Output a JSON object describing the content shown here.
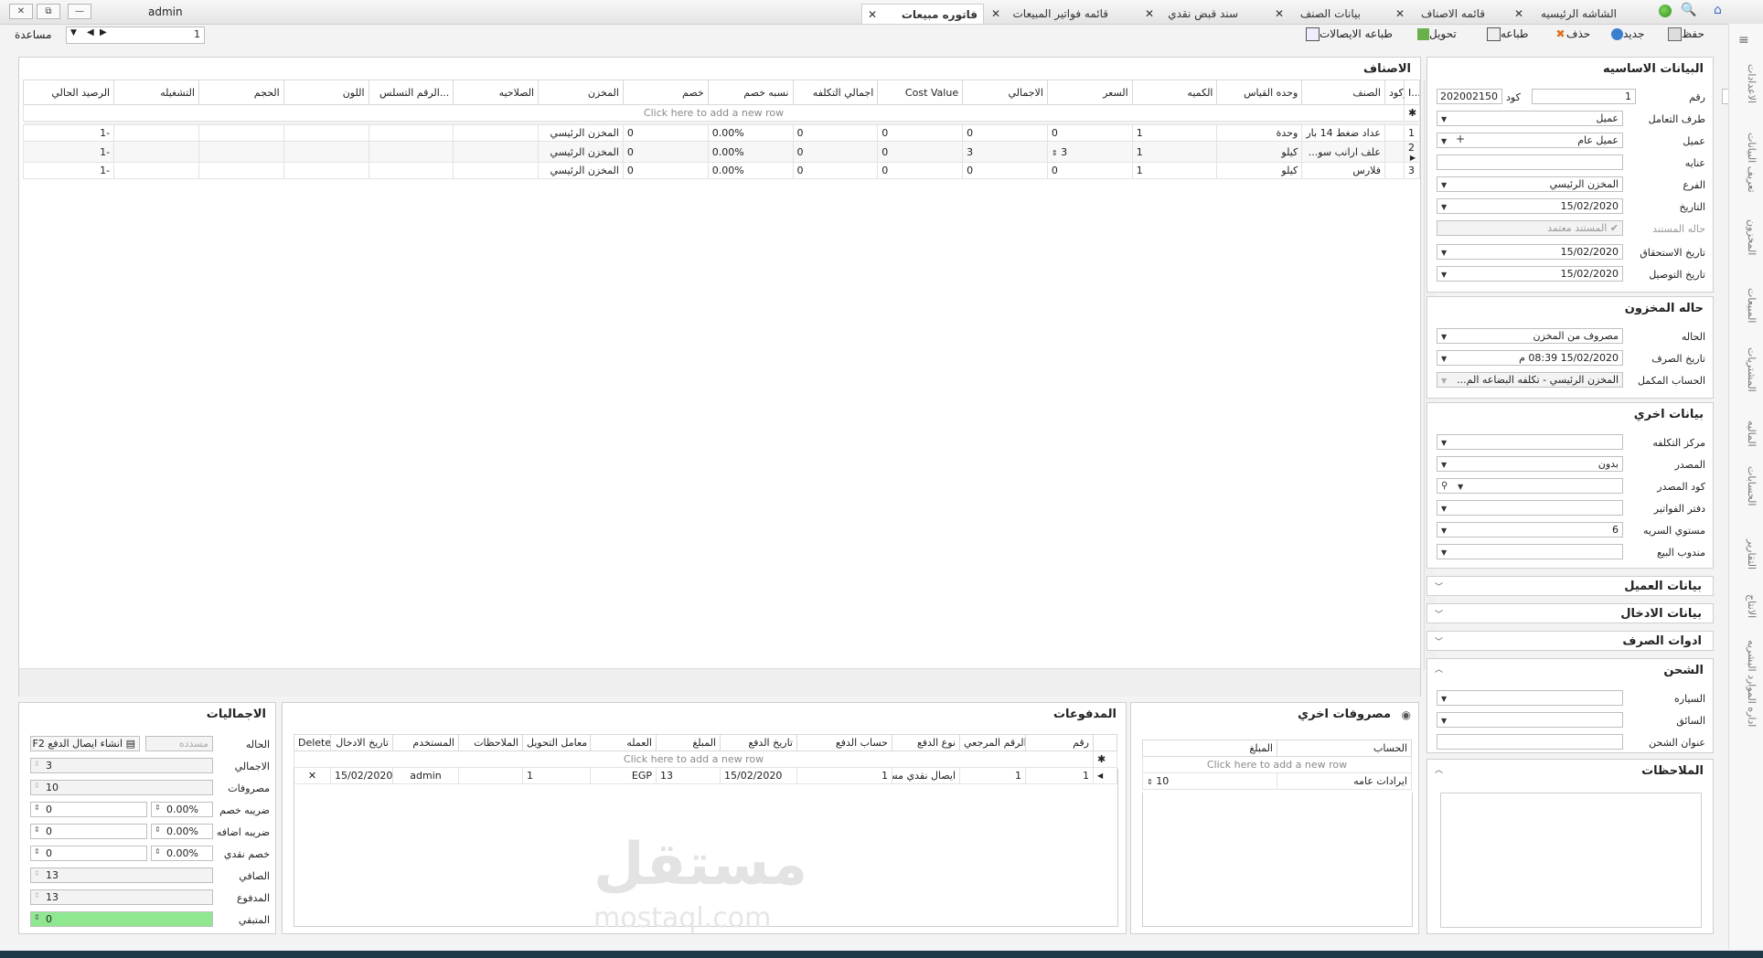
{
  "window": {
    "user": "admin",
    "close": "✕",
    "restore": "⧉",
    "minimize": "—"
  },
  "tabs": [
    {
      "label": "الشاشه الرئيسيه"
    },
    {
      "label": "قائمه الاصناف"
    },
    {
      "label": "بيانات الصنف"
    },
    {
      "label": "سند قبض نقدي"
    },
    {
      "label": "قائمه فواتير المبيعات"
    },
    {
      "label": "فاتوره مبيعات"
    }
  ],
  "toolbar": {
    "save": "حفظ",
    "new": "جديد",
    "delete": "حذف",
    "print": "طباعه",
    "convert": "تحويل",
    "print_receipts": "طباعه الايصالات",
    "help": "مساعدة",
    "record_no": "1"
  },
  "basic": {
    "title": "البيانات الاساسيه",
    "number_label": "رقم",
    "number": "1",
    "code_label": "كود",
    "code": "202002150",
    "party_label": "طرف التعامل",
    "party": "عميل",
    "customer_label": "عميل",
    "customer": "عميل عام",
    "address_label": "عنايه",
    "address": "",
    "branch_label": "الفرع",
    "branch": "المخزن الرئيسي",
    "date_label": "التاريخ",
    "date": "15/02/2020",
    "doc_state_label": "حاله المستند",
    "doc_state": "المستند معتمد",
    "due_label": "تاريخ الاستحقاق",
    "due": "15/02/2020",
    "delivery_label": "تاريخ التوصيل",
    "delivery": "15/02/2020"
  },
  "stock": {
    "title": "حاله المخزون",
    "state_label": "الحاله",
    "state": "مصروف من المخزن",
    "issue_date_label": "تاريخ الصرف",
    "issue_date": "15/02/2020 08:39 م",
    "account_label": "الحساب المكمل",
    "account": "المخزن الرئيسي - تكلفه البضاعه الم..."
  },
  "other": {
    "title": "بيانات اخري",
    "cost_center_label": "مركز التكلفه",
    "cost_center": "",
    "source_label": "المصدر",
    "source": "بدون",
    "source_code_label": "كود المصدر",
    "source_code": "",
    "invoice_book_label": "دفتر الفواتير",
    "invoice_book": "",
    "privacy_label": "مستوي السريه",
    "privacy": "6",
    "sales_rep_label": "مندوب البيع",
    "sales_rep": ""
  },
  "sections": {
    "customer_data": "بيانات العميل",
    "entry_data": "بيانات الادخال",
    "issue_tools": "ادوات الصرف",
    "shipping": "الشحن",
    "car_label": "السياره",
    "driver_label": "السائق",
    "ship_address_label": "عنوان الشحن",
    "notes": "الملاحظات"
  },
  "items": {
    "title": "الاصناف",
    "new_row": "Click here to add a new row",
    "columns": [
      "I...",
      "باركود",
      "الصنف",
      "وحده القياس",
      "الكميه",
      "السعر",
      "الاجمالي",
      "Cost Value",
      "اجمالي التكلفه",
      "نسبه خصم",
      "خصم",
      "المخزن",
      "الصلاحيه",
      "الرقم التسلس...",
      "اللون",
      "الحجم",
      "التشغيله",
      "الرصيد الحالي"
    ],
    "rows": [
      {
        "i": "1",
        "barcode": "",
        "item": "عداد ضغط 14 بار",
        "unit": "وحدة",
        "qty": "1",
        "price": "0",
        "total": "0",
        "cost_value": "0",
        "total_cost": "0",
        "disc_pct": "0.00%",
        "disc": "0",
        "store": "المخزن الرئيسي",
        "expiry": "",
        "serial": "",
        "color": "",
        "size": "",
        "batch": "",
        "balance": "-1"
      },
      {
        "i": "2",
        "barcode": "",
        "item": "علف ارانب سو...",
        "unit": "كيلو",
        "qty": "1",
        "price": "3",
        "total": "3",
        "cost_value": "0",
        "total_cost": "0",
        "disc_pct": "0.00%",
        "disc": "0",
        "store": "المخزن الرئيسي",
        "expiry": "",
        "serial": "",
        "color": "",
        "size": "",
        "batch": "",
        "balance": "-1"
      },
      {
        "i": "3",
        "barcode": "",
        "item": "فلارس",
        "unit": "كيلو",
        "qty": "1",
        "price": "0",
        "total": "0",
        "cost_value": "0",
        "total_cost": "0",
        "disc_pct": "0.00%",
        "disc": "0",
        "store": "المخزن الرئيسي",
        "expiry": "",
        "serial": "",
        "color": "",
        "size": "",
        "batch": "",
        "balance": "-1"
      }
    ]
  },
  "expenses": {
    "title": "مصروفات اخري",
    "columns": [
      "الحساب",
      "المبلغ"
    ],
    "new_row": "Click here to add a new row",
    "rows": [
      {
        "account": "ايرادات عامه",
        "amount": "10"
      }
    ]
  },
  "payments": {
    "title": "المدفوعات",
    "columns": [
      "رقم",
      "الرقم المرجعي",
      "نوع الدفع",
      "حساب الدفع",
      "تاريخ الدفع",
      "المبلغ",
      "العمله",
      "معامل التحويل",
      "الملاحظات",
      "المستخدم",
      "تاريخ الادخال",
      "Delete"
    ],
    "new_row": "Click here to add a new row",
    "rows": [
      {
        "no": "1",
        "ref": "1",
        "type": "ايصال نقدي مسبق",
        "account": "1",
        "date": "15/02/2020",
        "amount": "13",
        "currency": "EGP",
        "rate": "1",
        "notes": "",
        "user": "admin",
        "entry_date": "15/02/2020",
        "delete": "✕"
      }
    ]
  },
  "totals": {
    "title": "الاجماليات",
    "state_label": "الحاله",
    "state": "مسدده",
    "create_receipt": "انشاء ايصال الدفع F2",
    "total_label": "الاجمالي",
    "total": "3",
    "expenses_label": "مصروفات",
    "expenses": "10",
    "disc_tax_label": "ضريبه خصم",
    "disc_tax_pct": "0.00%",
    "disc_tax": "0",
    "add_tax_label": "ضريبه اضافه",
    "add_tax_pct": "0.00%",
    "add_tax": "0",
    "cash_disc_label": "خصم نقدي",
    "cash_disc_pct": "0.00%",
    "cash_disc": "0",
    "net_label": "الصافي",
    "net": "13",
    "paid_label": "المدفوع",
    "paid": "13",
    "remaining_label": "المتبقي",
    "remaining": "0"
  },
  "side_tabs": [
    "الاعدادات",
    "تعريف البيانات",
    "المخزون",
    "المبيعات",
    "المشتريات",
    "الماليه",
    "الحسابات",
    "التقارير",
    "الانتاج",
    "اداره الموارد البشريه"
  ],
  "watermark": {
    "arabic": "مستقل",
    "latin": "mostaql.com"
  },
  "colors": {
    "remaining_bg": "#8fe88f",
    "accent": "#4a90d9"
  }
}
